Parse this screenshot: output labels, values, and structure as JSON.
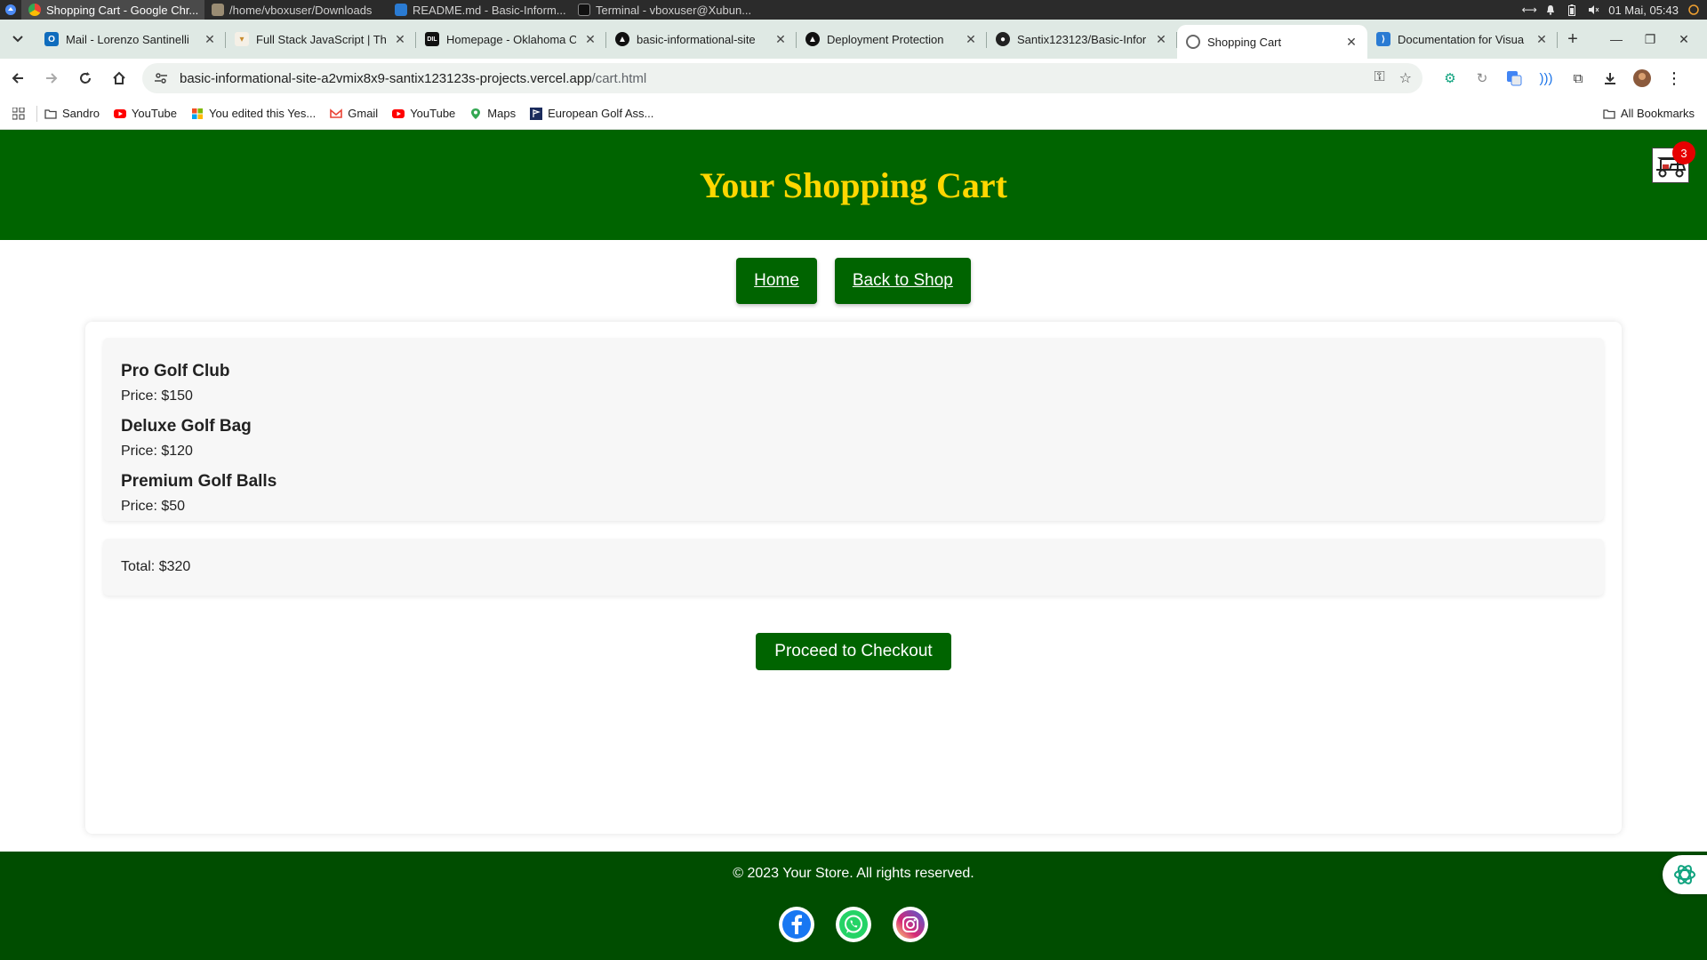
{
  "taskbar": {
    "tasks": [
      {
        "label": "Shopping Cart - Google Chr...",
        "active": true
      },
      {
        "label": "/home/vboxuser/Downloads",
        "active": false
      },
      {
        "label": "README.md - Basic-Inform...",
        "active": false
      },
      {
        "label": "Terminal - vboxuser@Xubun...",
        "active": false
      }
    ],
    "clock": "01 Mai, 05:43"
  },
  "browser": {
    "tabs": [
      {
        "label": "Mail - Lorenzo Santinelli",
        "active": false
      },
      {
        "label": "Full Stack JavaScript | The",
        "active": false
      },
      {
        "label": "Homepage - Oklahoma C",
        "active": false
      },
      {
        "label": "basic-informational-site",
        "active": false
      },
      {
        "label": "Deployment Protection",
        "active": false
      },
      {
        "label": "Santix123123/Basic-Infor",
        "active": false
      },
      {
        "label": "Shopping Cart",
        "active": true
      },
      {
        "label": "Documentation for Visua",
        "active": false
      }
    ],
    "url_host": "basic-informational-site-a2vmix8x9-santix123123s-projects.vercel.app",
    "url_path": "/cart.html",
    "bookmarks": [
      {
        "label": "Sandro",
        "icon": "folder-icon"
      },
      {
        "label": "YouTube",
        "icon": "youtube-icon"
      },
      {
        "label": "You edited this Yes...",
        "icon": "microsoft-icon"
      },
      {
        "label": "Gmail",
        "icon": "gmail-icon"
      },
      {
        "label": "YouTube",
        "icon": "youtube-icon"
      },
      {
        "label": "Maps",
        "icon": "maps-icon"
      },
      {
        "label": "European Golf Ass...",
        "icon": "golf-icon"
      }
    ],
    "all_bookmarks": "All Bookmarks"
  },
  "site": {
    "title": "Your Shopping Cart",
    "cart_count": "3",
    "nav": {
      "home": "Home",
      "back": "Back to Shop"
    },
    "items": [
      {
        "name": "Pro Golf Club",
        "price": "Price: $150"
      },
      {
        "name": "Deluxe Golf Bag",
        "price": "Price: $120"
      },
      {
        "name": "Premium Golf Balls",
        "price": "Price: $50"
      }
    ],
    "total": "Total: $320",
    "checkout": "Proceed to Checkout",
    "footer": "© 2023 Your Store. All rights reserved.",
    "socials": [
      "facebook-icon",
      "whatsapp-icon",
      "instagram-icon"
    ]
  },
  "colors": {
    "header_green": "#006400",
    "footer_green": "#004d00",
    "title_gold": "#ffd700",
    "badge_red": "#e60000"
  }
}
